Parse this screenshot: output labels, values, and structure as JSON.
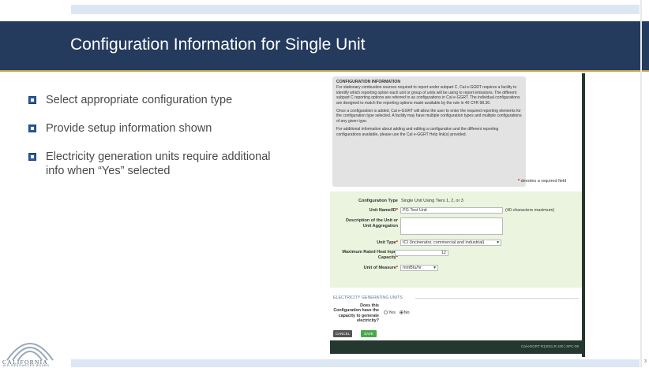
{
  "slide": {
    "title": "Configuration Information for Single Unit",
    "bullets": [
      "Select appropriate configuration type",
      "Provide setup information shown",
      "Electricity generation units require additional info when “Yes” selected"
    ],
    "page_number": "3",
    "logo": {
      "name": "CALIFORNIA",
      "sub": "AIR RESOURCES BOARD"
    }
  },
  "screenshot": {
    "info_heading": "CONFIGURATION INFORMATION",
    "info_p1": "For stationary combustion sources required to report under subpart C, Cal e-GGRT requires a facility to identify which reporting option each unit or group of units will be using to report emissions. The different subpart C reporting options are referred to as configurations in Cal e-GGRT. The individual configurations are designed to match the reporting options made available by the rule in 40 CFR 98.36.",
    "info_p2": "Once a configuration is added, Cal e-GGRT will allow the user to enter the required reporting elements for the configuration type selected. A facility may have multiple configuration types and multiple configurations of any given type.",
    "info_p3": "For additional information about adding and editing a configuration and the different reporting configurations available, please use the Cal e-GGRT Help link(s) provided.",
    "required_note": "denotes a required field",
    "required_mark": "*",
    "form": {
      "config_type_label": "Configuration Type",
      "config_type_value": "Single Unit Using Tiers 1, 2, or 3",
      "unit_name_label": "Unit Name/ID",
      "unit_name_value": "PG Test Unit",
      "unit_name_note": "(40 characters maximum)",
      "description_label": "Description of the Unit or Unit Aggregation",
      "description_value": "",
      "unit_type_label": "Unit Type",
      "unit_type_value": "ICI (Incinerator, commercial and industrial)",
      "max_heat_label": "Maximum Rated Heat Input Capacity",
      "max_heat_value": "12",
      "uom_label": "Unit of Measure",
      "uom_value": "mmBtu/hr"
    },
    "electricity": {
      "section_title": "ELECTRICITY GENERATING UNITS",
      "question": "Does this Configuration have the capacity to generate electricity?",
      "yes_label": "Yes",
      "no_label": "No",
      "selected": "No"
    },
    "buttons": {
      "cancel": "CANCEL",
      "save": "SAVE"
    },
    "footer_text": "Cal-eGGRT R12011.R.100  |  SPC-08"
  },
  "colors": {
    "title_band": "#253b5e",
    "accent_rule": "#c9a24a",
    "bullet": "#2c5c9e",
    "form_bg": "#eaf4de",
    "footer": "#24382f",
    "save": "#4aa84a",
    "cancel": "#555555"
  }
}
